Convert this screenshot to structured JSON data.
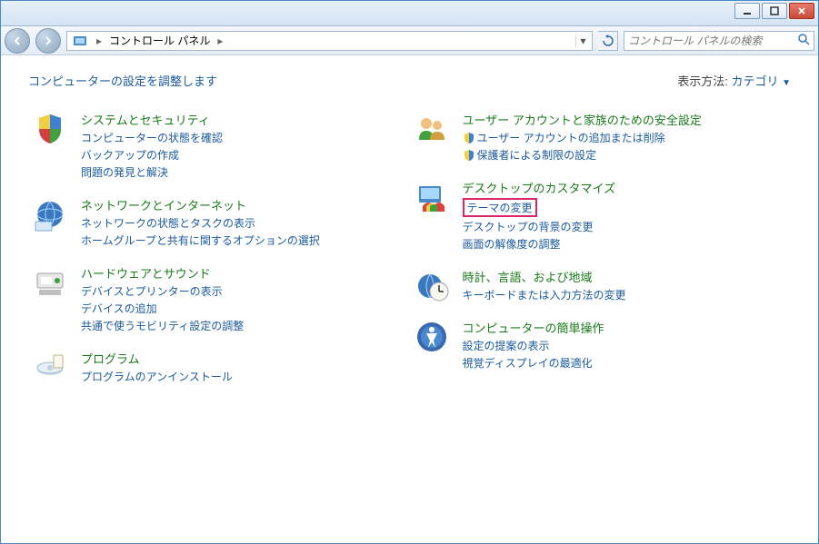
{
  "titlebar": {},
  "navbar": {
    "breadcrumb": "コントロール パネル",
    "search_placeholder": "コントロール パネルの検索"
  },
  "content": {
    "heading": "コンピューターの設定を調整します",
    "view_by_label": "表示方法:",
    "view_by_value": "カテゴリ"
  },
  "categories_left": [
    {
      "title": "システムとセキュリティ",
      "links": [
        {
          "text": "コンピューターの状態を確認",
          "shield": false
        },
        {
          "text": "バックアップの作成",
          "shield": false
        },
        {
          "text": "問題の発見と解決",
          "shield": false
        }
      ]
    },
    {
      "title": "ネットワークとインターネット",
      "links": [
        {
          "text": "ネットワークの状態とタスクの表示",
          "shield": false
        },
        {
          "text": "ホームグループと共有に関するオプションの選択",
          "shield": false
        }
      ]
    },
    {
      "title": "ハードウェアとサウンド",
      "links": [
        {
          "text": "デバイスとプリンターの表示",
          "shield": false
        },
        {
          "text": "デバイスの追加",
          "shield": false
        },
        {
          "text": "共通で使うモビリティ設定の調整",
          "shield": false
        }
      ]
    },
    {
      "title": "プログラム",
      "links": [
        {
          "text": "プログラムのアンインストール",
          "shield": false
        }
      ]
    }
  ],
  "categories_right": [
    {
      "title": "ユーザー アカウントと家族のための安全設定",
      "links": [
        {
          "text": "ユーザー アカウントの追加または削除",
          "shield": true
        },
        {
          "text": "保護者による制限の設定",
          "shield": true
        }
      ]
    },
    {
      "title": "デスクトップのカスタマイズ",
      "links": [
        {
          "text": "テーマの変更",
          "shield": false,
          "highlighted": true
        },
        {
          "text": "デスクトップの背景の変更",
          "shield": false
        },
        {
          "text": "画面の解像度の調整",
          "shield": false
        }
      ]
    },
    {
      "title": "時計、言語、および地域",
      "links": [
        {
          "text": "キーボードまたは入力方法の変更",
          "shield": false
        }
      ]
    },
    {
      "title": "コンピューターの簡単操作",
      "links": [
        {
          "text": "設定の提案の表示",
          "shield": false
        },
        {
          "text": "視覚ディスプレイの最適化",
          "shield": false
        }
      ]
    }
  ],
  "icons": {
    "left": [
      "shield-system",
      "network",
      "hardware",
      "programs"
    ],
    "right": [
      "user-accounts",
      "appearance",
      "clock-region",
      "ease-of-access"
    ]
  }
}
